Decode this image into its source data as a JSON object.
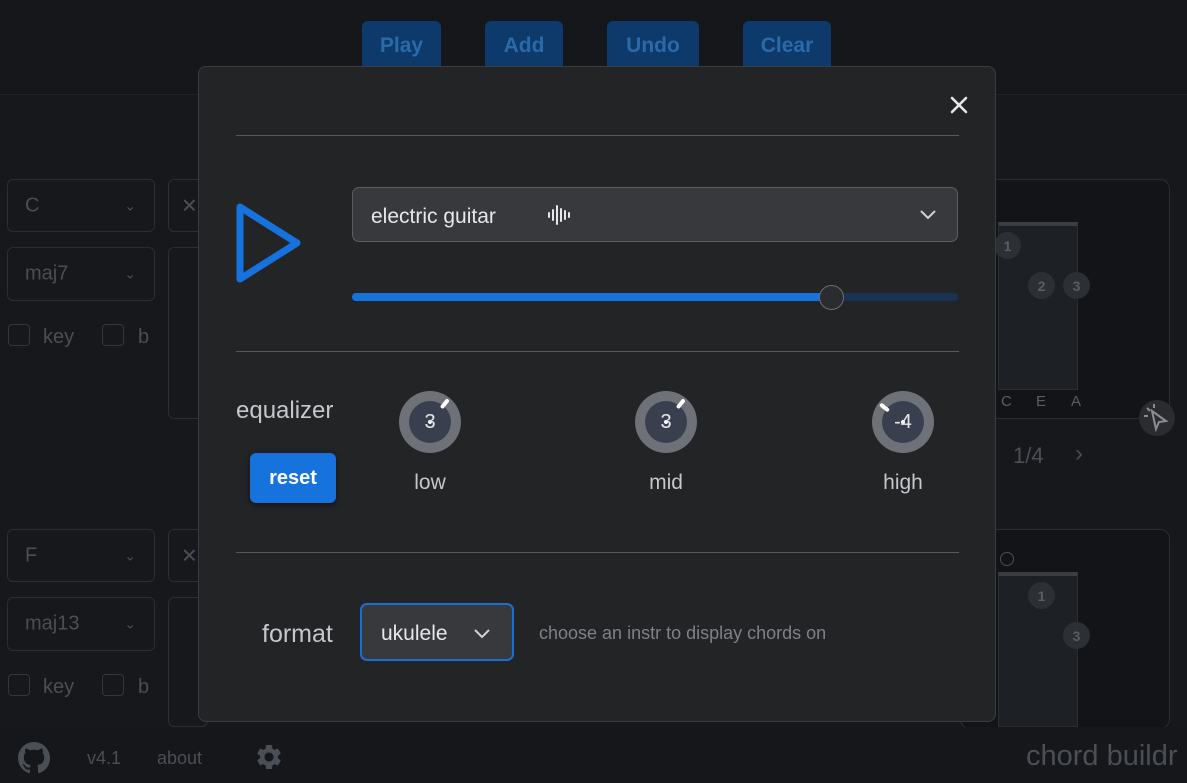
{
  "toolbar": {
    "play_label": "Play",
    "add_label": "Add",
    "undo_label": "Undo",
    "clear_label": "Clear"
  },
  "chord_rows": [
    {
      "root": "C",
      "quality": "maj7",
      "key_label": "key",
      "flat_label": "b"
    },
    {
      "root": "F",
      "quality": "maj13",
      "key_label": "key",
      "flat_label": "b"
    }
  ],
  "chart_card": {
    "strings": [
      "C",
      "E",
      "A"
    ],
    "page_indicator": "1/4",
    "finger_numbers_top": [
      "1",
      "2",
      "3"
    ],
    "finger_numbers_bottom": [
      "1",
      "3"
    ]
  },
  "footer": {
    "version": "v4.1",
    "about_label": "about",
    "brand": "chord buildr"
  },
  "modal": {
    "instrument": {
      "selected": "electric guitar"
    },
    "volume_fraction": 0.79,
    "equalizer": {
      "label": "equalizer",
      "reset_label": "reset",
      "bands": [
        {
          "label": "low",
          "value": "3"
        },
        {
          "label": "mid",
          "value": "3"
        },
        {
          "label": "high",
          "value": "-4"
        }
      ]
    },
    "format": {
      "label": "format",
      "selected": "ukulele",
      "hint": "choose an instr to display chords on"
    }
  },
  "colors": {
    "accent": "#1673de",
    "modal_bg": "#232426",
    "page_bg": "#16181b"
  },
  "icons": {
    "close": "close-icon",
    "play": "play-icon",
    "wave": "audio-wave-icon",
    "github": "github-icon",
    "settings": "gear-icon"
  }
}
